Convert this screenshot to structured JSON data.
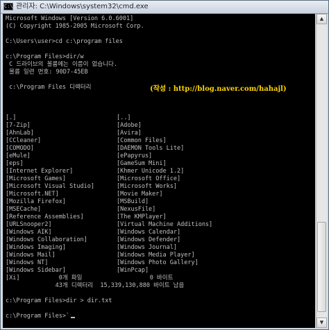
{
  "window": {
    "title": "관리자: C:\\Windows\\system32\\cmd.exe",
    "icon_name": "cmd-icon",
    "icon_glyph": "C:\\"
  },
  "console": {
    "header": [
      "Microsoft Windows [Version 6.0.6001]",
      "(C) Copyright 1985-2005 Microsoft Corp."
    ],
    "cmd1": "C:\\Users\\user>cd c:\\program files",
    "cmd2": "c:\\Program Files>dir/w",
    "volume": [
      " C 드라이브의 볼륨에는 이름이 없습니다.",
      " 볼륨 일련 번호: 90D7-45EB"
    ],
    "dir_of": " c:\\Program Files 디렉터리",
    "annotation": "(작성 : http://blog.naver.com/hahajl)",
    "listing_left": [
      "[.]",
      "[7-Zip]",
      "[AhnLab]",
      "[CCleaner]",
      "[COMODO]",
      "[eMule]",
      "[eps]",
      "[Internet Explorer]",
      "[Microsoft Games]",
      "[Microsoft Visual Studio]",
      "[Microsoft.NET]",
      "[Mozilla Firefox]",
      "[MSECache]",
      "[Reference Assemblies]",
      "[URLSnooper2]",
      "[Windows AIK]",
      "[Windows Collaboration]",
      "[Windows Imaging]",
      "[Windows Mail]",
      "[Windows NT]",
      "[Windows Sidebar]",
      "[Xi]"
    ],
    "listing_right": [
      "[..]",
      "[Adobe]",
      "[Avira]",
      "[Common Files]",
      "[DAEMON Tools Lite]",
      "[ePapyrus]",
      "[GameSum Mini]",
      "[Khmer Unicode 1.2]",
      "[Microsoft Office]",
      "[Microsoft Works]",
      "[Movie Maker]",
      "[MSBuild]",
      "[NexusFile]",
      "[The KMPlayer]",
      "[Virtual Machine Additions]",
      "[Windows Calendar]",
      "[Windows Defender]",
      "[Windows Journal]",
      "[Windows Media Player]",
      "[Windows Photo Gallery]",
      "[WinPcap]"
    ],
    "summary": [
      "               0개 파일                   0 바이트",
      "              43개 디렉터리  15,339,130,880 바이트 남음"
    ],
    "cmd3": "c:\\Program Files>dir > dir.txt",
    "prompt": "c:\\Program Files>`",
    "colors": {
      "background": "#000000",
      "text": "#c0c0c0",
      "annotation": "#ffd400"
    }
  },
  "scrollbar": {
    "up_glyph": "▲",
    "down_glyph": "▼"
  }
}
